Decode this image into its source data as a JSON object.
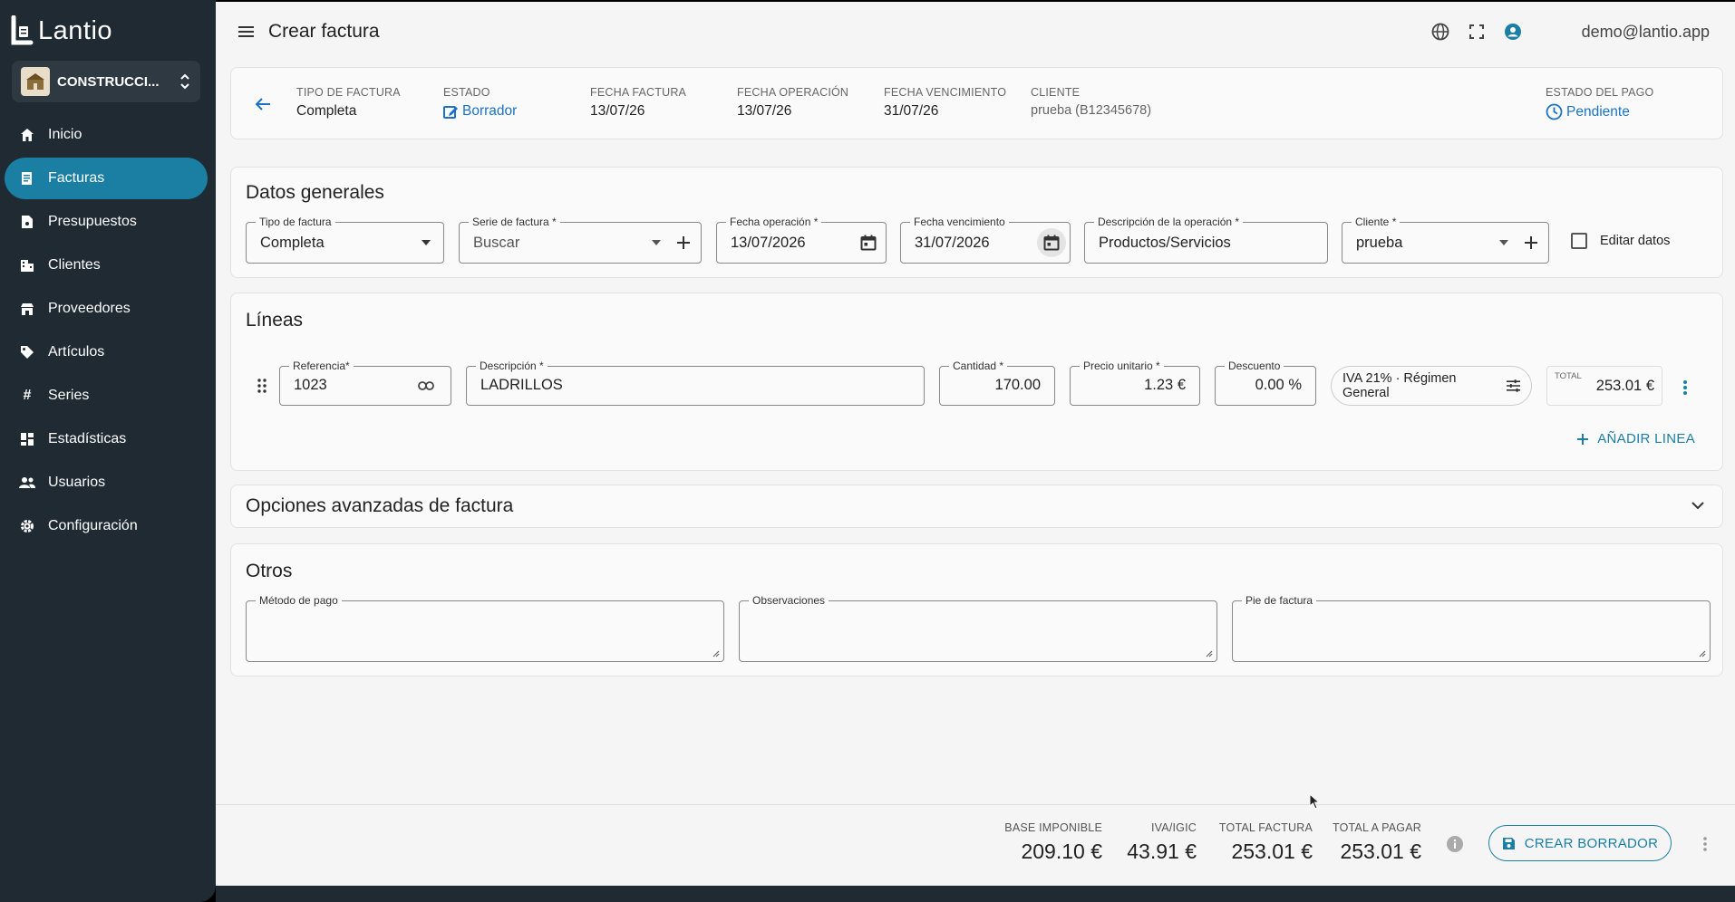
{
  "app": {
    "logo_text": "Lantio"
  },
  "company": {
    "name": "CONSTRUCCI..."
  },
  "sidebar": {
    "items": [
      {
        "label": "Inicio",
        "icon": "home-icon"
      },
      {
        "label": "Facturas",
        "icon": "receipt-icon",
        "active": true
      },
      {
        "label": "Presupuestos",
        "icon": "document-icon"
      },
      {
        "label": "Clientes",
        "icon": "building-icon"
      },
      {
        "label": "Proveedores",
        "icon": "store-icon"
      },
      {
        "label": "Artículos",
        "icon": "tag-icon"
      },
      {
        "label": "Series",
        "icon": "hash-icon"
      },
      {
        "label": "Estadísticas",
        "icon": "dashboard-icon"
      },
      {
        "label": "Usuarios",
        "icon": "users-icon"
      },
      {
        "label": "Configuración",
        "icon": "gear-icon"
      }
    ]
  },
  "header": {
    "title": "Crear factura",
    "user_email": "demo@lantio.app"
  },
  "summary": {
    "tipo_label": "TIPO DE FACTURA",
    "tipo_value": "Completa",
    "estado_label": "ESTADO",
    "estado_value": "Borrador",
    "fecha_factura_label": "FECHA FACTURA",
    "fecha_factura_value": "13/07/26",
    "fecha_operacion_label": "FECHA OPERACIÓN",
    "fecha_operacion_value": "13/07/26",
    "fecha_vencimiento_label": "FECHA VENCIMIENTO",
    "fecha_vencimiento_value": "31/07/26",
    "cliente_label": "CLIENTE",
    "cliente_value": "prueba (B12345678)",
    "estado_pago_label": "ESTADO DEL PAGO",
    "estado_pago_value": "Pendiente"
  },
  "datos_generales": {
    "title": "Datos generales",
    "tipo_label": "Tipo de factura",
    "tipo_value": "Completa",
    "serie_label": "Serie de factura *",
    "serie_placeholder": "Buscar",
    "fecha_op_label": "Fecha operación *",
    "fecha_op_value": "13/07/2026",
    "fecha_venc_label": "Fecha vencimiento",
    "fecha_venc_value": "31/07/2026",
    "descripcion_label": "Descripción de la operación *",
    "descripcion_value": "Productos/Servicios",
    "cliente_label": "Cliente *",
    "cliente_value": "prueba",
    "editar_label": "Editar datos"
  },
  "lineas": {
    "title": "Líneas",
    "rows": [
      {
        "referencia_label": "Referencia*",
        "referencia": "1023",
        "descripcion_label": "Descripción *",
        "descripcion": "LADRILLOS",
        "cantidad_label": "Cantidad *",
        "cantidad": "170.00",
        "precio_label": "Precio unitario *",
        "precio": "1.23 €",
        "descuento_label": "Descuento",
        "descuento": "0.00 %",
        "iva": "IVA 21% · Régimen General",
        "total_label": "TOTAL",
        "total": "253.01 €"
      }
    ],
    "add_label": "AÑADIR LINEA"
  },
  "opciones": {
    "title": "Opciones avanzadas de factura"
  },
  "otros": {
    "title": "Otros",
    "metodo_label": "Método de pago",
    "observaciones_label": "Observaciones",
    "pie_label": "Pie de factura"
  },
  "totals": {
    "base_label": "BASE IMPONIBLE",
    "base_value": "209.10 €",
    "iva_label": "IVA/IGIC",
    "iva_value": "43.91 €",
    "total_factura_label": "TOTAL FACTURA",
    "total_factura_value": "253.01 €",
    "total_pagar_label": "TOTAL A PAGAR",
    "total_pagar_value": "253.01 €",
    "create_label": "CREAR BORRADOR"
  },
  "colors": {
    "accent": "#1a7fa3",
    "sidebar": "#1f2a33",
    "link": "#1a73c4"
  }
}
